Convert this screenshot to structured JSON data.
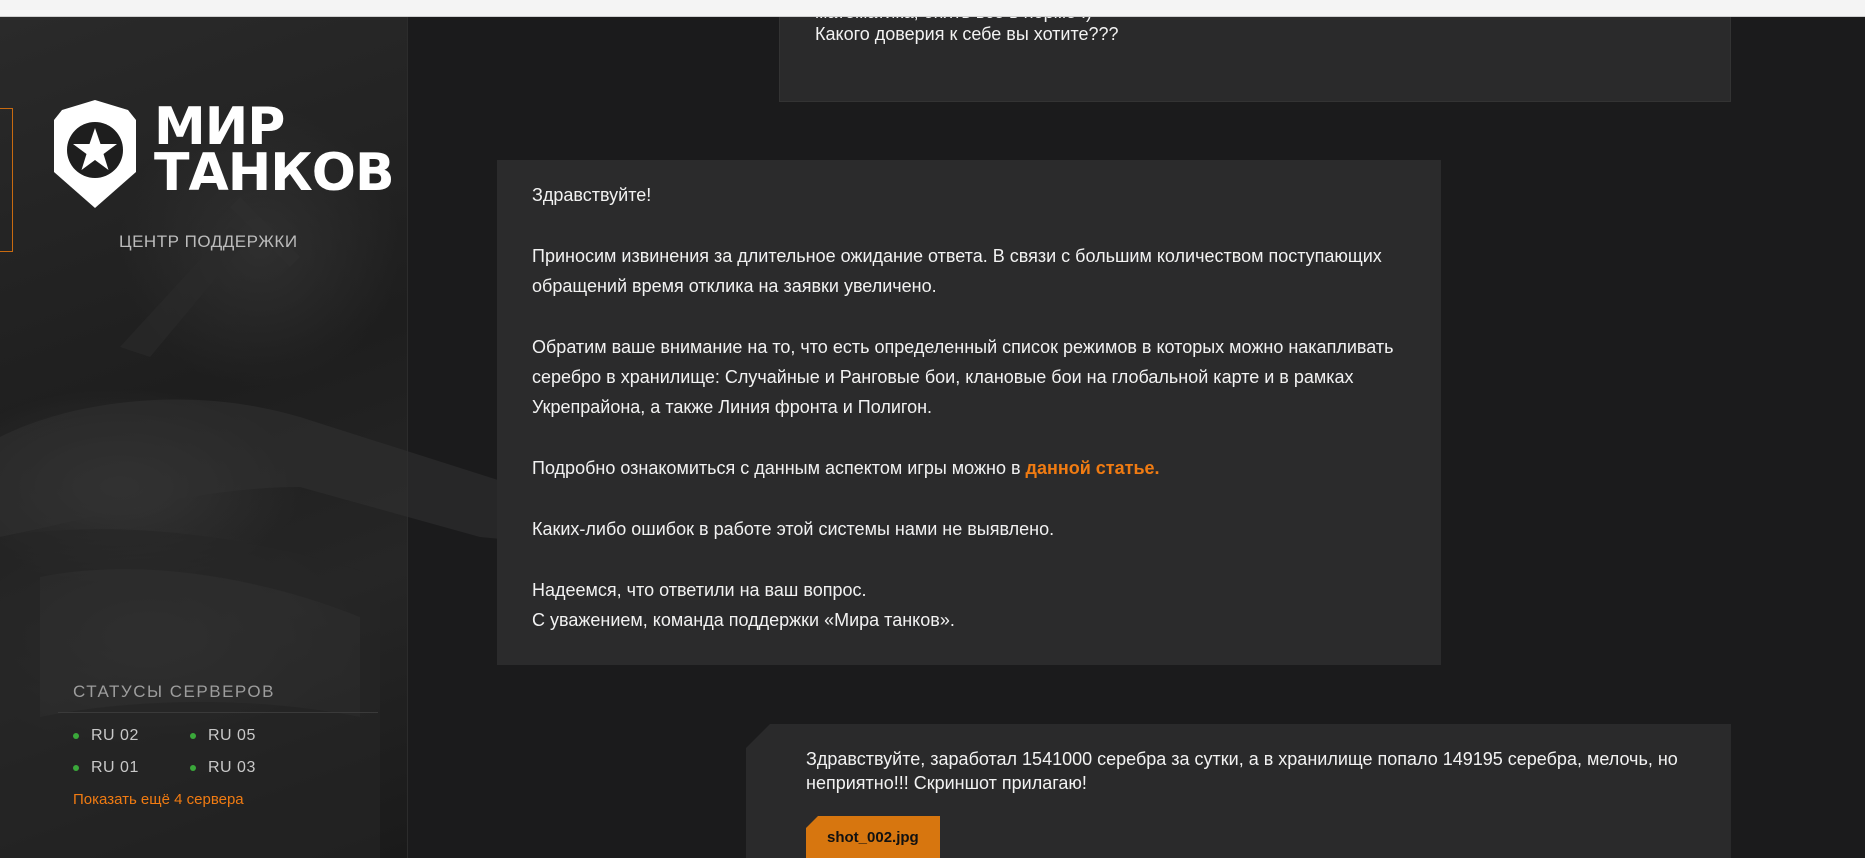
{
  "brand": {
    "logo_line1": "МИР",
    "logo_line2": "ТАНКОВ",
    "support_center": "ЦЕНТР ПОДДЕРЖКИ"
  },
  "servers": {
    "title": "СТАТУСЫ СЕРВЕРОВ",
    "items": [
      {
        "name": "RU 02",
        "status_color": "#3aa83a"
      },
      {
        "name": "RU 05",
        "status_color": "#3aa83a"
      },
      {
        "name": "RU 01",
        "status_color": "#3aa83a"
      },
      {
        "name": "RU 03",
        "status_color": "#3aa83a"
      }
    ],
    "show_more": "Показать ещё 4 сервера"
  },
  "messages": {
    "user_top": {
      "line1": "математика, опять все в норме :)",
      "line2": "Какого доверия к себе вы хотите???"
    },
    "support": {
      "greeting": "Здравствуйте!",
      "p1": "Приносим извинения за длительное ожидание ответа. В связи с большим количеством поступающих обращений время отклика на заявки увеличено.",
      "p2": "Обратим ваше внимание на то, что есть определенный список режимов в которых можно накапливать серебро в хранилище: Случайные и Ранговые бои, клановые бои на глобальной карте и в рамках Укрепрайона, а также Линия фронта и Полигон.",
      "p3_text": "Подробно ознакомиться с данным аспектом игры можно в ",
      "p3_link": "данной статье.",
      "p4": "Каких-либо ошибок в работе этой системы нами не выявлено.",
      "p5_line1": "Надеемся, что ответили на ваш вопрос.",
      "p5_line2": "С уважением, команда поддержки «Мира танков»."
    },
    "user_bottom": {
      "text": "Здравствуйте, заработал 1541000 серебра за сутки, а в хранилище попало 149195 серебра, мелочь, но неприятно!!! Скриншот прилагаю!",
      "attachment": "shot_002.jpg"
    }
  },
  "colors": {
    "accent": "#f07b12",
    "attachment_bg": "#d7760f",
    "status_online": "#3aa83a"
  }
}
